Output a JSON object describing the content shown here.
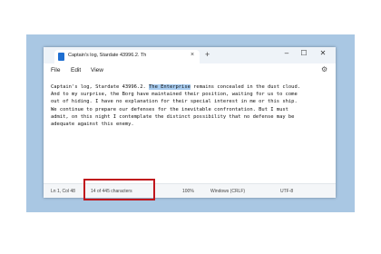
{
  "app": {
    "tab_title": "Captain's log, Stardate 43996.2. Th",
    "tab_close": "×",
    "new_tab": "+"
  },
  "window_controls": {
    "minimize": "–",
    "maximize": "☐",
    "close": "✕"
  },
  "menu": {
    "file": "File",
    "edit": "Edit",
    "view": "View"
  },
  "document": {
    "line1_before": "Captain's log, Stardate 43996.2. ",
    "line1_selected": "The Enterprise",
    "line1_after": " remains concealed in the dust cloud.",
    "line2": "And to my surprise, the Borg have maintained their position, waiting for us to come",
    "line3": "out of hiding. I have no explanation for their special interest in me or this ship.",
    "line4": "We continue to prepare our defenses for the inevitable confrontation. But I must",
    "line5": "admit, on this night I contemplate the distinct possibility that no defense may be",
    "line6": "adequate against this enemy."
  },
  "status": {
    "cursor": "Ln 1, Col 48",
    "characters": "14 of 445 characters",
    "zoom": "100%",
    "line_ending": "Windows (CRLF)",
    "encoding": "UTF-8"
  },
  "colors": {
    "selection": "#a8cdf2",
    "highlight_box": "#c0161d",
    "backdrop": "#a9c7e3"
  }
}
